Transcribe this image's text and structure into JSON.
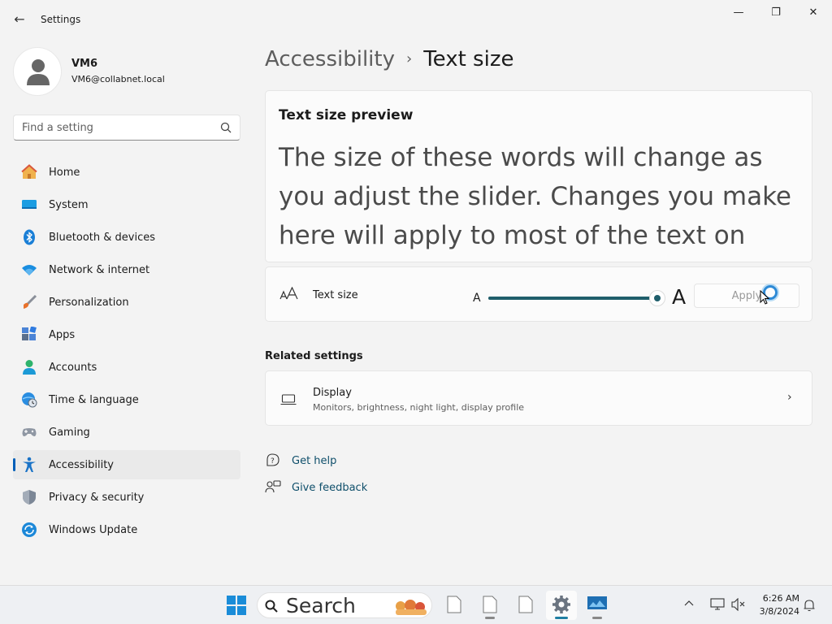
{
  "window": {
    "title": "Settings",
    "back_glyph": "←",
    "min_glyph": "—",
    "max_glyph": "❐",
    "close_glyph": "✕"
  },
  "profile": {
    "name": "VM6",
    "email": "VM6@collabnet.local"
  },
  "search": {
    "placeholder": "Find a setting"
  },
  "sidebar": {
    "items": [
      {
        "label": "Home",
        "icon": "home-icon"
      },
      {
        "label": "System",
        "icon": "system-icon"
      },
      {
        "label": "Bluetooth & devices",
        "icon": "bluetooth-icon"
      },
      {
        "label": "Network & internet",
        "icon": "wifi-icon"
      },
      {
        "label": "Personalization",
        "icon": "brush-icon"
      },
      {
        "label": "Apps",
        "icon": "apps-icon"
      },
      {
        "label": "Accounts",
        "icon": "accounts-icon"
      },
      {
        "label": "Time & language",
        "icon": "globe-clock-icon"
      },
      {
        "label": "Gaming",
        "icon": "gamepad-icon"
      },
      {
        "label": "Accessibility",
        "icon": "accessibility-icon",
        "active": true
      },
      {
        "label": "Privacy & security",
        "icon": "shield-icon"
      },
      {
        "label": "Windows Update",
        "icon": "update-icon"
      }
    ]
  },
  "breadcrumb": {
    "parent": "Accessibility",
    "separator": "›",
    "current": "Text size"
  },
  "preview": {
    "title": "Text size preview",
    "text": "The size of these words will change as you adjust the slider. Changes you make here will apply to most of the text on"
  },
  "text_size": {
    "label": "Text size",
    "small_a": "A",
    "large_a": "A",
    "slider_value_percent": 100,
    "apply_label": "Apply"
  },
  "related": {
    "heading": "Related settings",
    "display_title": "Display",
    "display_subtitle": "Monitors, brightness, night light, display profile",
    "chevron": "›"
  },
  "help": {
    "get_help": "Get help",
    "give_feedback": "Give feedback"
  },
  "taskbar": {
    "search_label": "Search",
    "tray_chevron": "^",
    "time": "6:26 AM",
    "date": "3/8/2024"
  },
  "colors": {
    "accent": "#005fb8",
    "slider": "#1f5e6b",
    "link": "#0f4f6b"
  }
}
